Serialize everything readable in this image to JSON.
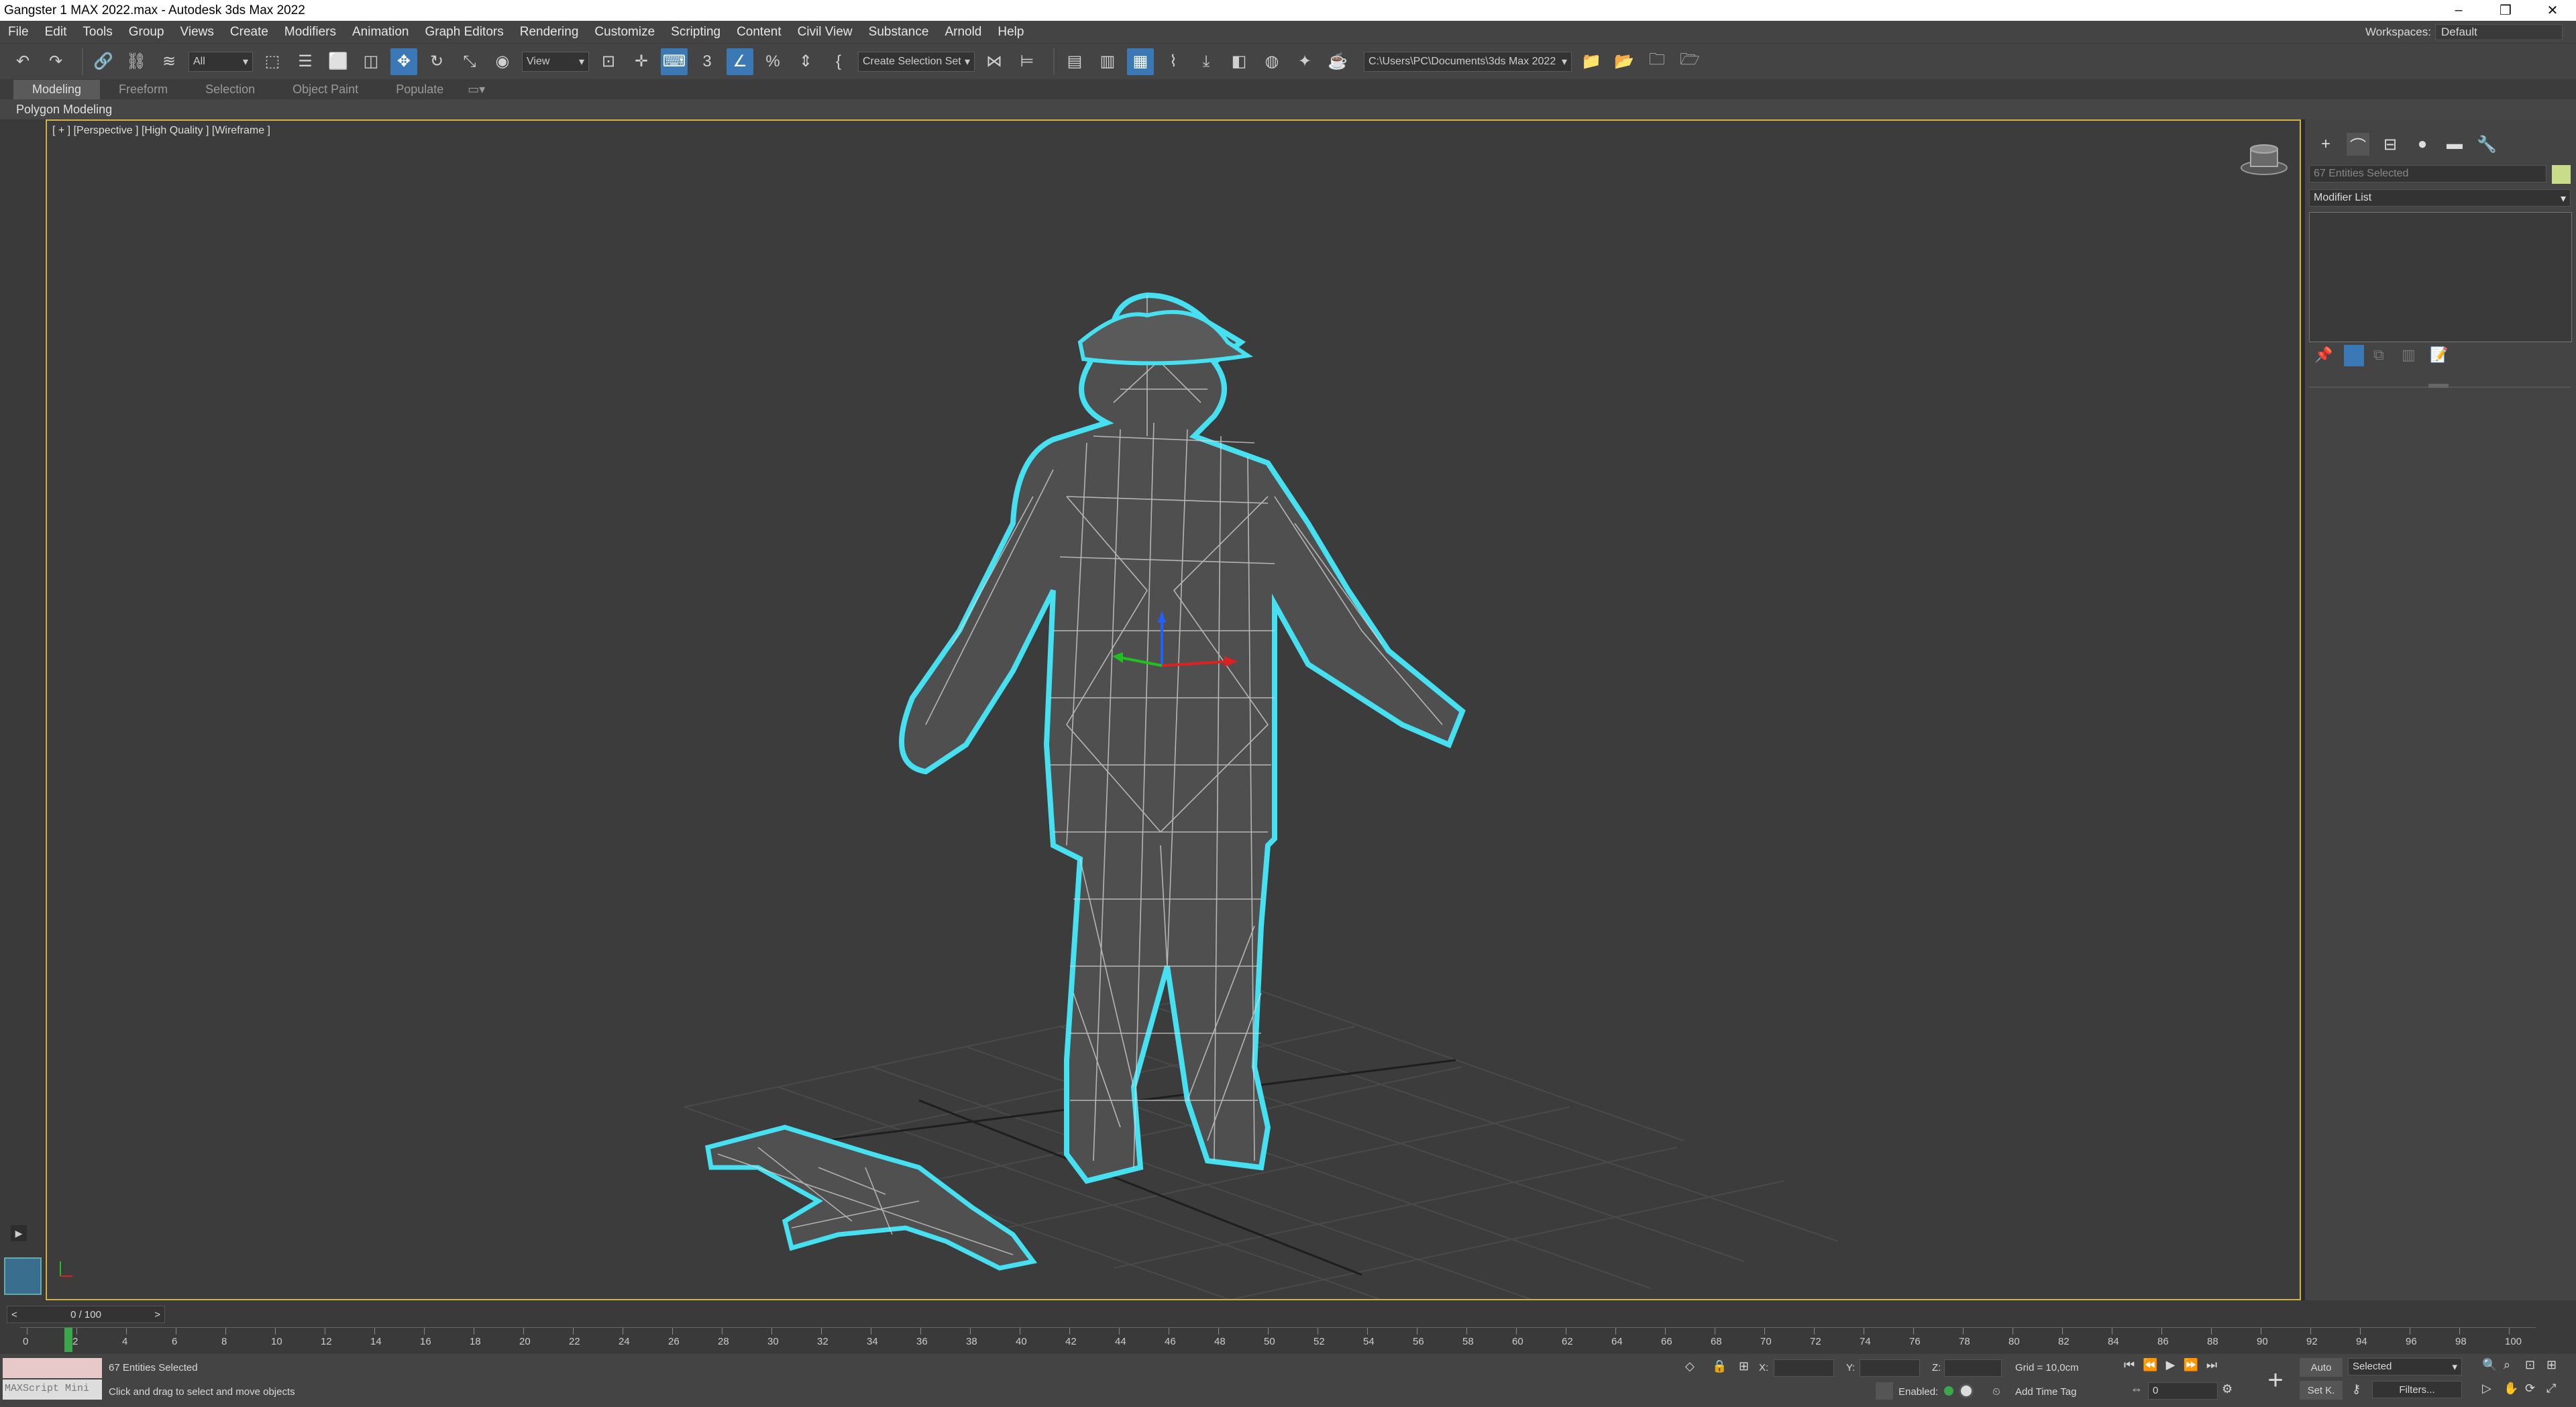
{
  "window": {
    "title": "Gangster 1 MAX 2022.max - Autodesk 3ds Max 2022"
  },
  "menu": [
    "File",
    "Edit",
    "Tools",
    "Group",
    "Views",
    "Create",
    "Modifiers",
    "Animation",
    "Graph Editors",
    "Rendering",
    "Customize",
    "Scripting",
    "Content",
    "Civil View",
    "Substance",
    "Arnold",
    "Help"
  ],
  "workspace": {
    "label": "Workspaces:",
    "value": "Default"
  },
  "toolbar": {
    "filter": "All",
    "ref_coord": "View",
    "named_set": "Create Selection Set",
    "path": "C:\\Users\\PC\\Documents\\3ds Max 2022"
  },
  "ribbon": {
    "tabs": [
      "Modeling",
      "Freeform",
      "Selection",
      "Object Paint",
      "Populate"
    ],
    "sub": "Polygon Modeling"
  },
  "viewport": {
    "label": "[ + ] [Perspective ] [High Quality ] [Wireframe ]"
  },
  "command_panel": {
    "selection_name": "67 Entities Selected",
    "modifier_list": "Modifier List",
    "swatch_color": "#c8dc8a"
  },
  "timeline": {
    "frame": "0 / 100",
    "ticks": [
      "0",
      "2",
      "4",
      "6",
      "8",
      "10",
      "12",
      "14",
      "16",
      "18",
      "20",
      "22",
      "24",
      "26",
      "28",
      "30",
      "32",
      "34",
      "36",
      "38",
      "40",
      "42",
      "44",
      "46",
      "48",
      "50",
      "52",
      "54",
      "56",
      "58",
      "60",
      "62",
      "64",
      "66",
      "68",
      "70",
      "72",
      "74",
      "76",
      "78",
      "80",
      "82",
      "84",
      "86",
      "88",
      "90",
      "92",
      "94",
      "96",
      "98",
      "100"
    ]
  },
  "status": {
    "maxscript": "MAXScript Mini",
    "selected": "67 Entities Selected",
    "prompt": "Click and drag to select and move objects",
    "x_label": "X:",
    "y_label": "Y:",
    "z_label": "Z:",
    "grid": "Grid = 10,0cm",
    "enabled": "Enabled:",
    "add_time_tag": "Add Time Tag",
    "auto": "Auto",
    "setk": "Set K.",
    "key_mode": "Selected",
    "filters": "Filters...",
    "frame_field": "0"
  },
  "colors": {
    "selection": "#46e0f0",
    "viewport_border": "#d4b24a",
    "active_tool": "#3b79b6"
  }
}
